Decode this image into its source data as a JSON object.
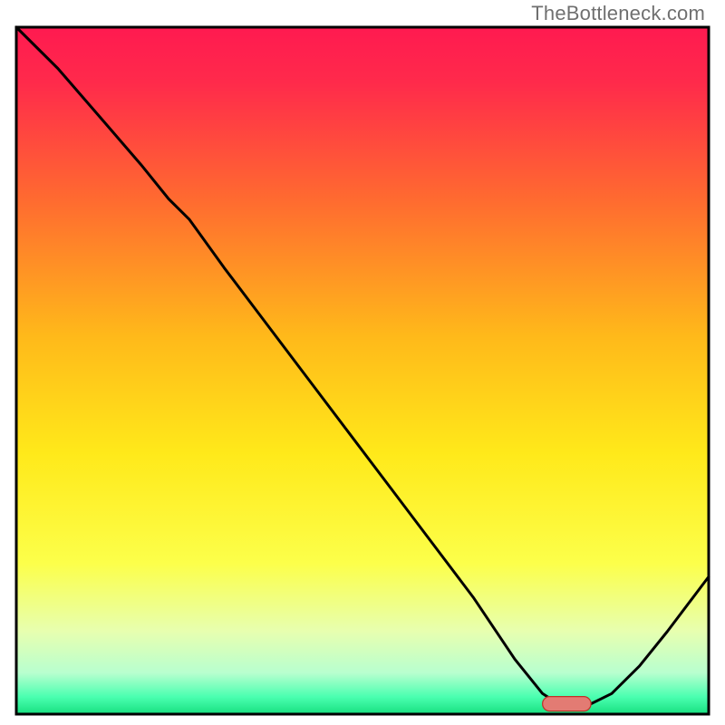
{
  "watermark": "TheBottleneck.com",
  "chart_data": {
    "type": "line",
    "title": "",
    "xlabel": "",
    "ylabel": "",
    "xlim": [
      0,
      100
    ],
    "ylim": [
      0,
      100
    ],
    "note": "Axes have no tick labels in the image; values are normalized 0–100. Y is bottleneck severity (0 = optimal/green, 100 = worst/red). X is an unlabeled parameter axis. Values estimated from curve position relative to plot box.",
    "x": [
      0,
      6,
      12,
      18,
      22,
      25,
      30,
      36,
      42,
      48,
      54,
      60,
      66,
      72,
      76,
      79,
      82,
      86,
      90,
      94,
      100
    ],
    "y": [
      100,
      94,
      87,
      80,
      75,
      72,
      65,
      57,
      49,
      41,
      33,
      25,
      17,
      8,
      3,
      1,
      1,
      3,
      7,
      12,
      20
    ],
    "optimal_band": {
      "x_start": 76,
      "x_end": 83,
      "y": 1.5
    },
    "background_gradient": {
      "stops": [
        {
          "offset": 0.0,
          "color": "#ff1a50"
        },
        {
          "offset": 0.08,
          "color": "#ff2a4b"
        },
        {
          "offset": 0.25,
          "color": "#ff6a30"
        },
        {
          "offset": 0.45,
          "color": "#ffb91a"
        },
        {
          "offset": 0.62,
          "color": "#ffe91a"
        },
        {
          "offset": 0.78,
          "color": "#fcff4a"
        },
        {
          "offset": 0.88,
          "color": "#e7ffb0"
        },
        {
          "offset": 0.94,
          "color": "#b8ffcf"
        },
        {
          "offset": 0.975,
          "color": "#4affb0"
        },
        {
          "offset": 1.0,
          "color": "#18e080"
        }
      ]
    },
    "frame_color": "#000000",
    "line_color": "#000000",
    "line_width": 3,
    "marker": {
      "fill": "#e37b73",
      "stroke": "#c03028",
      "rx": 8,
      "height": 16,
      "width_scale": 0.8
    }
  }
}
